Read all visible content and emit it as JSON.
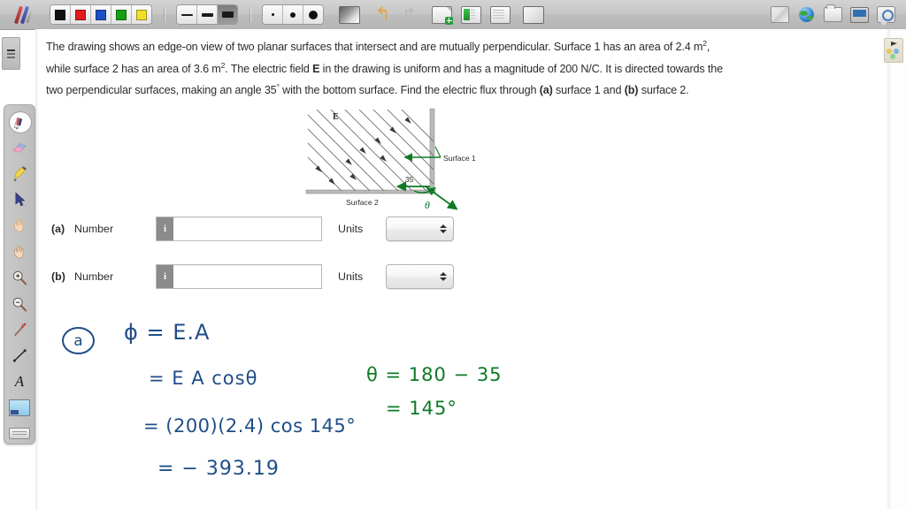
{
  "app": {
    "toolbar": {
      "pen_tool_icon": "pen-icon",
      "colors": [
        {
          "name": "black",
          "hex": "#111111"
        },
        {
          "name": "red",
          "hex": "#e01b1b"
        },
        {
          "name": "blue",
          "hex": "#1a4fc4"
        },
        {
          "name": "green",
          "hex": "#13a013"
        },
        {
          "name": "yellow",
          "hex": "#f2dd27"
        }
      ],
      "line_widths": [
        {
          "name": "thin",
          "px": 2
        },
        {
          "name": "medium",
          "px": 4
        },
        {
          "name": "thick",
          "px": 7,
          "selected": true
        }
      ],
      "dot_sizes": [
        {
          "name": "small",
          "px": 3
        },
        {
          "name": "medium",
          "px": 6
        },
        {
          "name": "large",
          "px": 10
        }
      ],
      "image_button": "image-icon",
      "undo_button": "undo-icon",
      "redo_button": "redo-icon",
      "new_page_button": "new-page-icon",
      "page_green_button": "page-green-icon",
      "page_plain_button": "page-plain-icon",
      "scribble_button": "scribble-icon",
      "right_icons": [
        {
          "name": "note-icon"
        },
        {
          "name": "globe-icon"
        },
        {
          "name": "folder-icon"
        },
        {
          "name": "presentation-icon"
        },
        {
          "name": "settings-icon"
        }
      ]
    },
    "palette": {
      "tools": [
        {
          "name": "pen-tool",
          "selected": true
        },
        {
          "name": "eraser-tool",
          "selected": false
        },
        {
          "name": "highlighter-tool",
          "selected": false
        },
        {
          "name": "pointer-tool",
          "selected": false
        },
        {
          "name": "hand-light-tool",
          "selected": false
        },
        {
          "name": "hand-tool",
          "selected": false
        },
        {
          "name": "zoom-in-tool",
          "selected": false
        },
        {
          "name": "zoom-out-tool",
          "selected": false
        },
        {
          "name": "laser-tool",
          "selected": false
        },
        {
          "name": "line-tool",
          "selected": false
        },
        {
          "name": "text-tool",
          "selected": false,
          "label": "A"
        },
        {
          "name": "snapshot-tool",
          "selected": false
        },
        {
          "name": "panel-tool",
          "selected": false
        }
      ]
    },
    "edge_tab": "sidebar-toggle"
  },
  "problem": {
    "line1_a": "The drawing shows an edge-on view of two planar surfaces that intersect and are mutually perpendicular. Surface 1 has an area of",
    "line2_a": "2.4 m",
    "line2_sup1": "2",
    "line2_b": ", while surface 2 has an area of 3.6 m",
    "line2_sup2": "2",
    "line2_c": ". The electric field ",
    "line2_bold": "E",
    "line2_d": " in the drawing is uniform and has a magnitude of 200 N/C. It is",
    "line3_a": "directed towards the two perpendicular surfaces, making an angle 35",
    "line3_deg": "°",
    "line3_b": " with the bottom surface. Find the electric flux through ",
    "line3_bold": "(a)",
    "line4_a": "surface 1 and ",
    "line4_bold": "(b)",
    "line4_b": " surface 2."
  },
  "diagram": {
    "field_label": "E",
    "surface1_label": "Surface 1",
    "surface2_label": "Surface 2",
    "angle_label": "35",
    "theta_label": "θ"
  },
  "answers": [
    {
      "part": "(a)",
      "number_label": "Number",
      "info_icon": "i",
      "number_value": "",
      "number_placeholder": "",
      "units_label": "Units",
      "units_value": ""
    },
    {
      "part": "(b)",
      "number_label": "Number",
      "info_icon": "i",
      "number_value": "",
      "number_placeholder": "",
      "units_label": "Units",
      "units_value": ""
    }
  ],
  "handwriting": {
    "ink_blue": "#1f4e87",
    "ink_green": "#0e7a25",
    "part_marker": "a",
    "line1": "ϕ =    E.A",
    "line2": "=  E A cosθ",
    "line3": "=  (200)(2.4) cos 145°",
    "line4": "=  − 393.19",
    "green_line1": "θ = 180 − 35",
    "green_line2": "= 145°"
  }
}
